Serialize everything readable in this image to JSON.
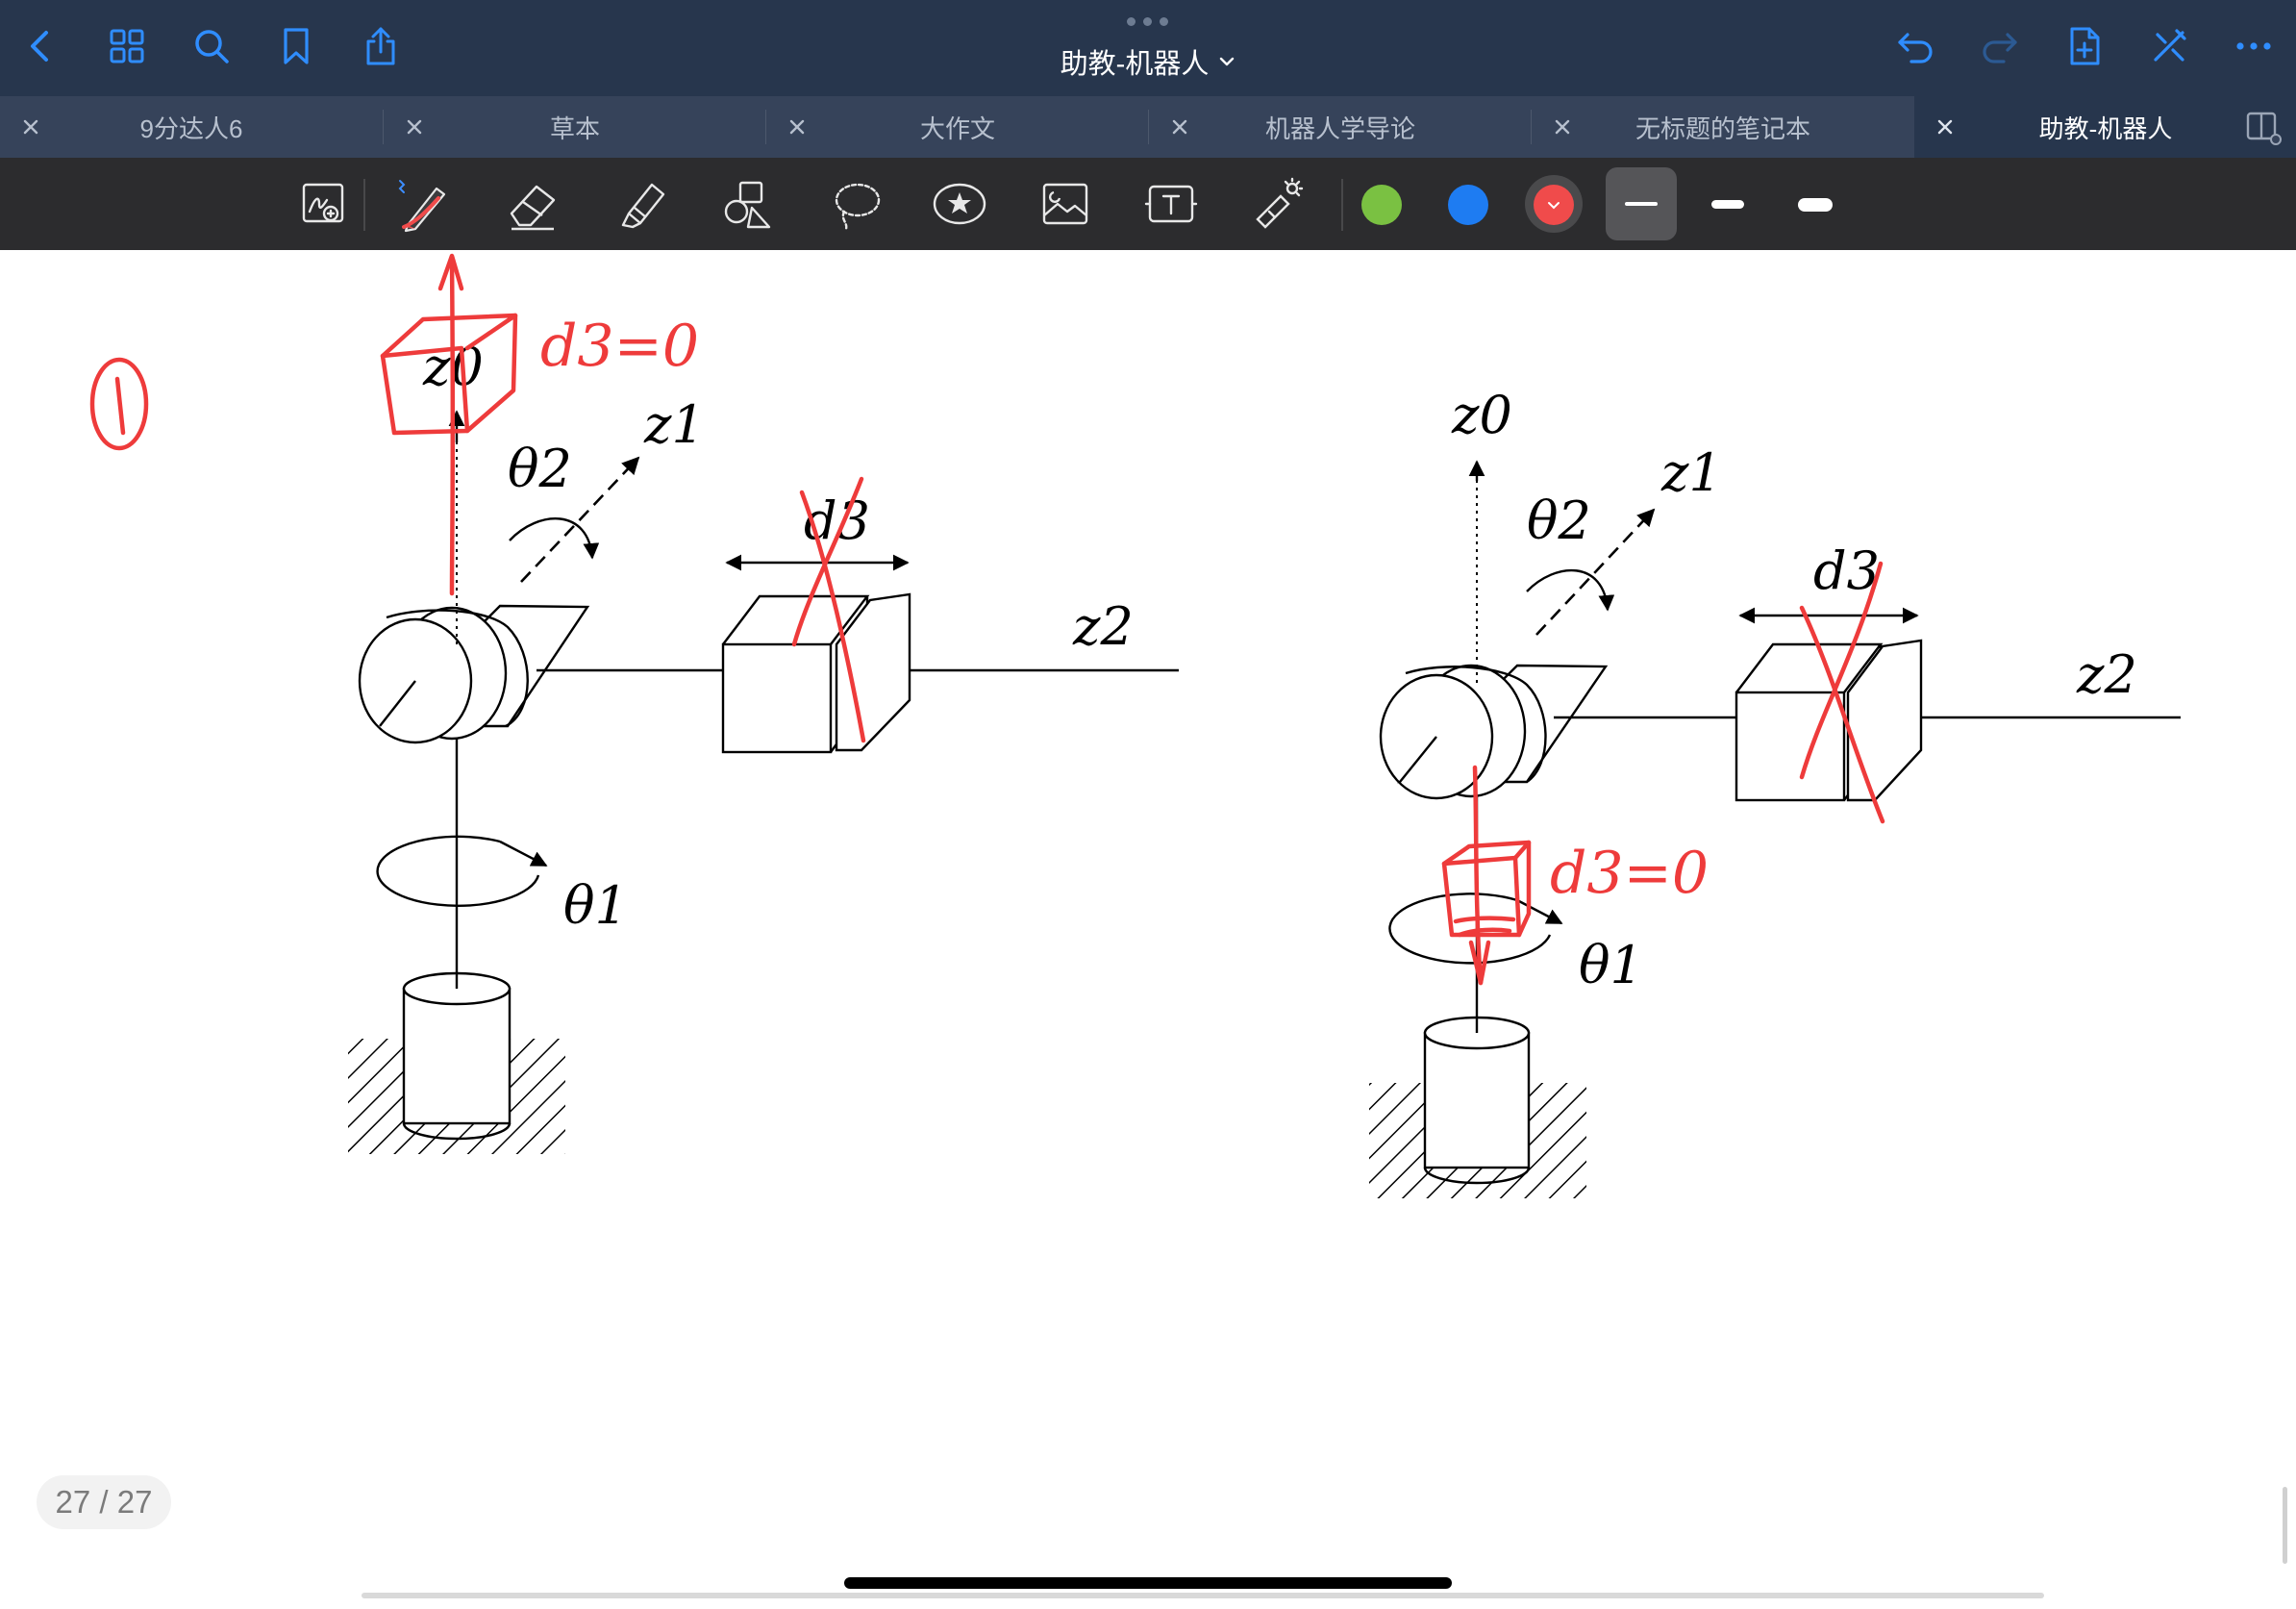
{
  "nav": {
    "title": "助教-机器人",
    "accent_color": "#2f8dff",
    "left_icons": [
      "back-chevron-icon",
      "grid-icon",
      "search-icon",
      "bookmark-icon",
      "share-icon"
    ],
    "right_icons": [
      "undo-icon",
      "redo-icon",
      "add-page-icon",
      "close-toolbar-icon",
      "more-icon"
    ]
  },
  "tabs": [
    {
      "label": "9分达人6",
      "active": false
    },
    {
      "label": "草本",
      "active": false
    },
    {
      "label": "大作文",
      "active": false
    },
    {
      "label": "机器人学导论",
      "active": false
    },
    {
      "label": "无标题的笔记本",
      "active": false
    },
    {
      "label": "助教-机器人",
      "active": true
    }
  ],
  "toolbar": {
    "tools": [
      "zoom-window-icon",
      "pen-icon",
      "eraser-icon",
      "highlighter-icon",
      "shapes-icon",
      "lasso-icon",
      "sticker-icon",
      "image-icon",
      "text-icon",
      "laser-pointer-icon"
    ],
    "colors": [
      "#7ac142",
      "#1e7cf2",
      "#f04b4b"
    ],
    "selected_color": "#f04b4b",
    "selected_stroke": "thin"
  },
  "figure": {
    "left": {
      "labels": {
        "z0": "z0",
        "z1": "z1",
        "z2": "z2",
        "theta1": "θ1",
        "theta2": "θ2",
        "d3": "d3"
      },
      "annotation": "d3=0",
      "circled_number": "1"
    },
    "right": {
      "labels": {
        "z0": "z0",
        "z1": "z1",
        "z2": "z2",
        "theta1": "θ1",
        "theta2": "θ2",
        "d3": "d3"
      },
      "annotation": "d3=0"
    }
  },
  "page_counter": "27 / 27"
}
